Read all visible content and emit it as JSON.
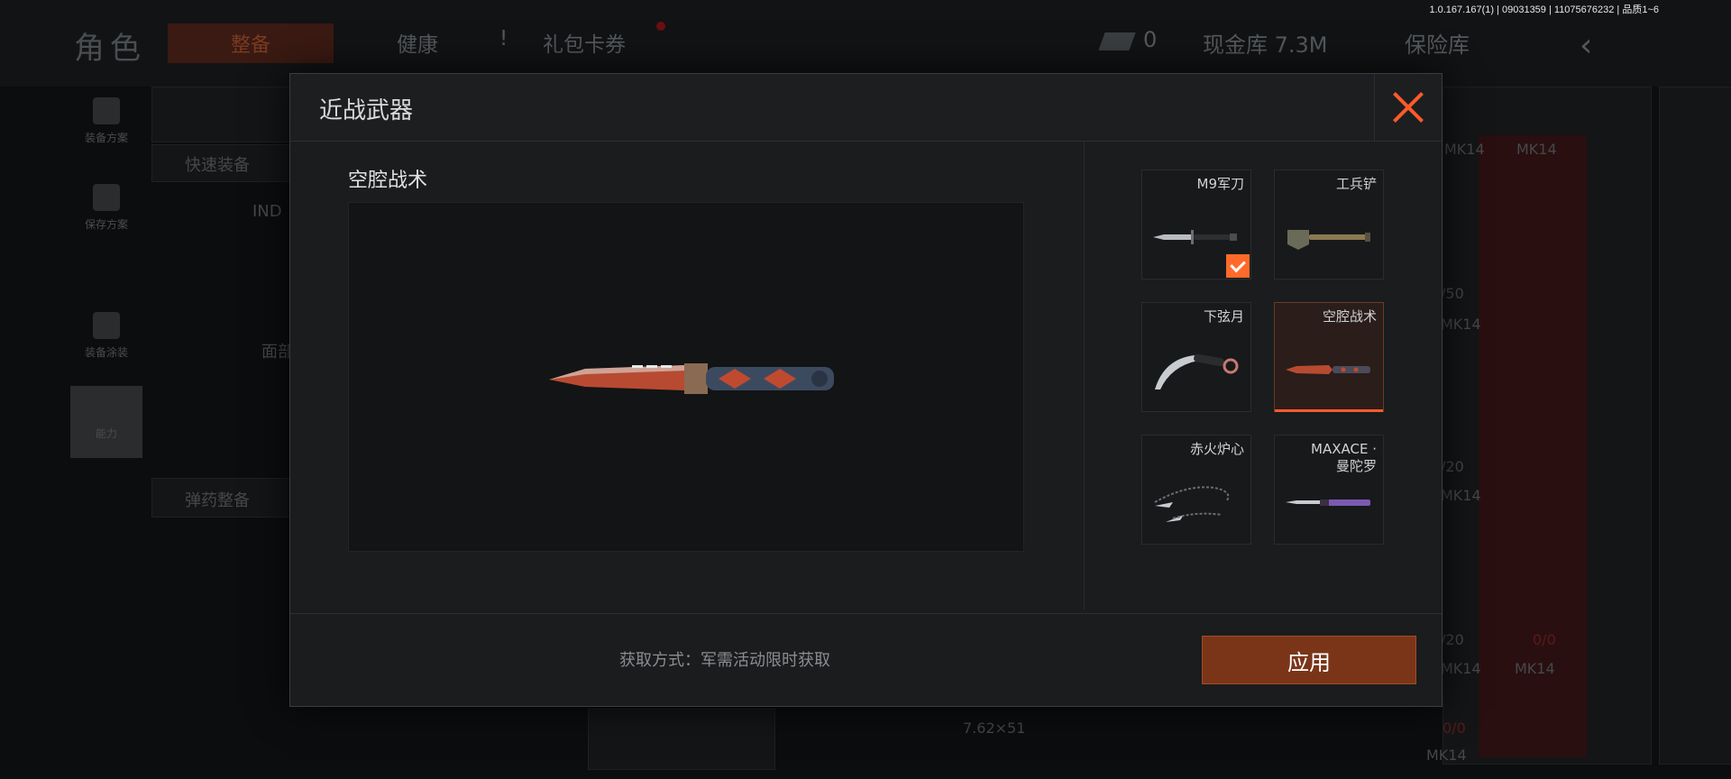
{
  "version": "1.0.167.167(1) | 09031359 | 11075676232 | 品质1~6",
  "background": {
    "title": "角色",
    "tabs": [
      "整备",
      "健康",
      "!",
      "礼包卡券"
    ],
    "currency_count": "0",
    "cash_label": "现金库 7.3M",
    "vault_label": "保险库",
    "side_buttons": [
      "装备方案",
      "保存方案",
      "装备涂装",
      "能力"
    ],
    "quick_equip": "快速装备",
    "ammo_equip": "弹药整备",
    "item_labels": [
      "IND",
      "面部",
      "MK14",
      "MK14",
      "MK14",
      "MK14",
      "MK14",
      "MK14",
      "/50",
      "/20",
      "/20",
      "0/0",
      "0/0",
      "7.62×51",
      "MK14"
    ]
  },
  "dialog": {
    "title": "近战武器",
    "preview_name": "空腔战术",
    "source_text": "获取方式：军需活动限时获取",
    "apply_label": "应用",
    "items": [
      {
        "name": "M9军刀",
        "equipped": true,
        "selected": false
      },
      {
        "name": "工兵铲",
        "equipped": false,
        "selected": false
      },
      {
        "name": "下弦月",
        "equipped": false,
        "selected": false
      },
      {
        "name": "空腔战术",
        "equipped": false,
        "selected": true
      },
      {
        "name": "赤火炉心",
        "equipped": false,
        "selected": false
      },
      {
        "name": "MAXACE ·\n曼陀罗",
        "equipped": false,
        "selected": false
      }
    ]
  },
  "colors": {
    "accent": "#ff5a2a",
    "apply_button": "#7a3519"
  }
}
